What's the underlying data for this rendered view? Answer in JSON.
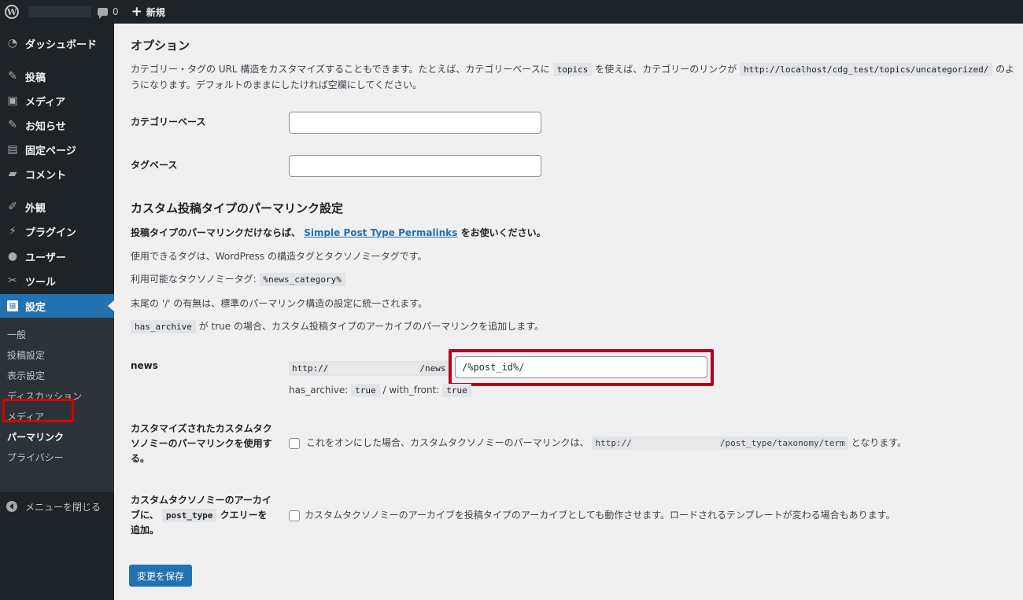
{
  "adminbar": {
    "comments_count": "0",
    "new_label": "新規",
    "wp_logo_icon": "wordpress-logo-icon"
  },
  "sidebar": {
    "items": [
      {
        "label": "ダッシュボード",
        "icon": "dashboard-icon"
      },
      {
        "label": "投稿",
        "icon": "pin-icon"
      },
      {
        "label": "メディア",
        "icon": "media-icon"
      },
      {
        "label": "お知らせ",
        "icon": "pin-icon"
      },
      {
        "label": "固定ページ",
        "icon": "page-icon"
      },
      {
        "label": "コメント",
        "icon": "comment-icon"
      },
      {
        "label": "外観",
        "icon": "brush-icon"
      },
      {
        "label": "プラグイン",
        "icon": "plugin-icon"
      },
      {
        "label": "ユーザー",
        "icon": "user-icon"
      },
      {
        "label": "ツール",
        "icon": "wrench-icon"
      },
      {
        "label": "設定",
        "icon": "settings-icon"
      }
    ],
    "submenu": [
      "一般",
      "投稿設定",
      "表示設定",
      "ディスカッション",
      "メディア",
      "パーマリンク",
      "プライバシー"
    ],
    "collapse_label": "メニューを閉じる",
    "active_color": "#2271b1"
  },
  "main": {
    "options_title": "オプション",
    "desc_part1": "カテゴリー・タグの URL 構造をカスタマイズすることもできます。たとえば、カテゴリーベースに",
    "desc_code1": "topics",
    "desc_part2": "を使えば、カテゴリーのリンクが",
    "desc_code2": "http://localhost/cdg_test/topics/uncategorized/",
    "desc_part3": "のよ",
    "desc_line2": "うになります。デフォルトのままにしたければ空欄にしてください。",
    "category_base_label": "カテゴリーベース",
    "category_base_value": "",
    "tag_base_label": "タグベース",
    "tag_base_value": "",
    "cpt_title": "カスタム投稿タイプのパーマリンク設定",
    "cpt_note_part1": "投稿タイプのパーマリンクだけならば、",
    "cpt_note_link": "Simple Post Type Permalinks",
    "cpt_note_part2": "をお使いください。",
    "tags_note": "使用できるタグは、WordPress の構造タグとタクソノミータグです。",
    "taxonomy_tags_label": "利用可能なタクソノミータグ:",
    "taxonomy_tags_code": "%news_category%",
    "trailing_note": "末尾の '/' の有無は、標準のパーマリンク構造の設定に統一されます。",
    "has_archive_code": "has_archive",
    "has_archive_note": "が true の場合、カスタム投稿タイプのアーカイブのパーマリンクを追加します。",
    "news_label": "news",
    "news_prefix": "http://",
    "news_suffix": "/news",
    "news_value": "/%post_id%/",
    "has_archive_label": "has_archive:",
    "has_archive_value": "true",
    "with_front_label": "/ with_front:",
    "with_front_value": "true",
    "ctax_label": "カスタマイズされたカスタムタクソノミーのパーマリンクを使用する。",
    "ctax_text1": "これをオンにした場合、カスタムタクソノミーのパーマリンクは、",
    "ctax_code_prefix": "http://",
    "ctax_code_suffix": "/post_type/taxonomy/term",
    "ctax_text2": "となります。",
    "archive_label_part1": "カスタムタクソノミーのアーカイブに、",
    "archive_label_code": "post_type",
    "archive_label_part2": "クエリーを追加。",
    "archive_text": "カスタムタクソノミーのアーカイブを投稿タイプのアーカイブとしても動作させます。ロードされるテンプレートが変わる場合もあります。",
    "save_label": "変更を保存",
    "highlight_color": "#b4001e"
  }
}
